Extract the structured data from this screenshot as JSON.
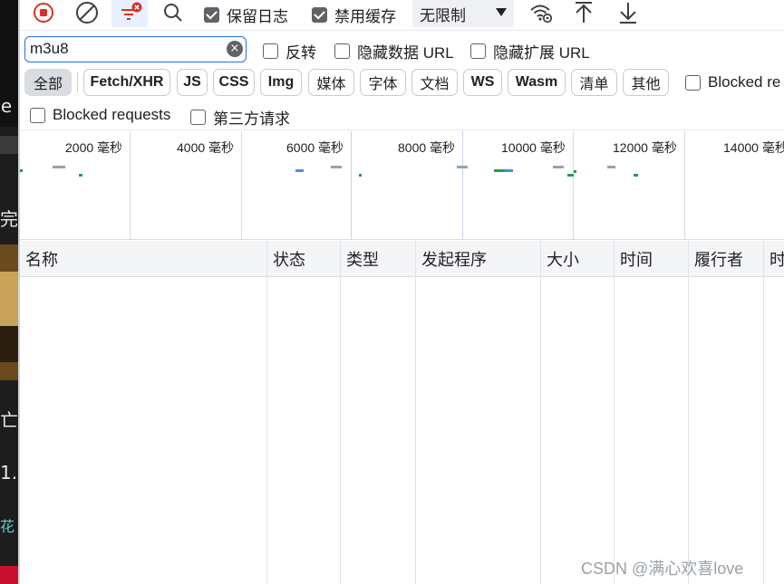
{
  "toolbar": {
    "record_icon": "record-stop-icon",
    "clear_icon": "clear-icon",
    "filter_icon": "filter-icon",
    "search_icon": "search-icon",
    "preserve_log_label": "保留日志",
    "disable_cache_label": "禁用缓存",
    "throttle_value": "无限制",
    "network_conditions_icon": "wifi-gear-icon",
    "import_icon": "upload-icon",
    "export_icon": "download-icon"
  },
  "filter": {
    "value": "m3u8",
    "clear_icon": "clear-circle-icon",
    "invert_label": "反转",
    "hide_data_urls_label": "隐藏数据 URL",
    "hide_extension_urls_label": "隐藏扩展 URL"
  },
  "type_filters": [
    "全部",
    "Fetch/XHR",
    "JS",
    "CSS",
    "Img",
    "媒体",
    "字体",
    "文档",
    "WS",
    "Wasm",
    "清单",
    "其他"
  ],
  "blocked_response_cookies_label": "Blocked re",
  "blocked_requests_label": "Blocked requests",
  "third_party_label": "第三方请求",
  "overview": {
    "ticks": [
      "2000 毫秒",
      "4000 毫秒",
      "6000 毫秒",
      "8000 毫秒",
      "10000 毫秒",
      "12000 毫秒",
      "14000 毫秒"
    ]
  },
  "table": {
    "columns": [
      "名称",
      "状态",
      "类型",
      "发起程序",
      "大小",
      "时间",
      "履行者",
      "时"
    ]
  },
  "watermark": "CSDN @满心欢喜love",
  "colors": {
    "accent": "#1a73e8",
    "record_red": "#d93025",
    "filter_red": "#d93025"
  }
}
